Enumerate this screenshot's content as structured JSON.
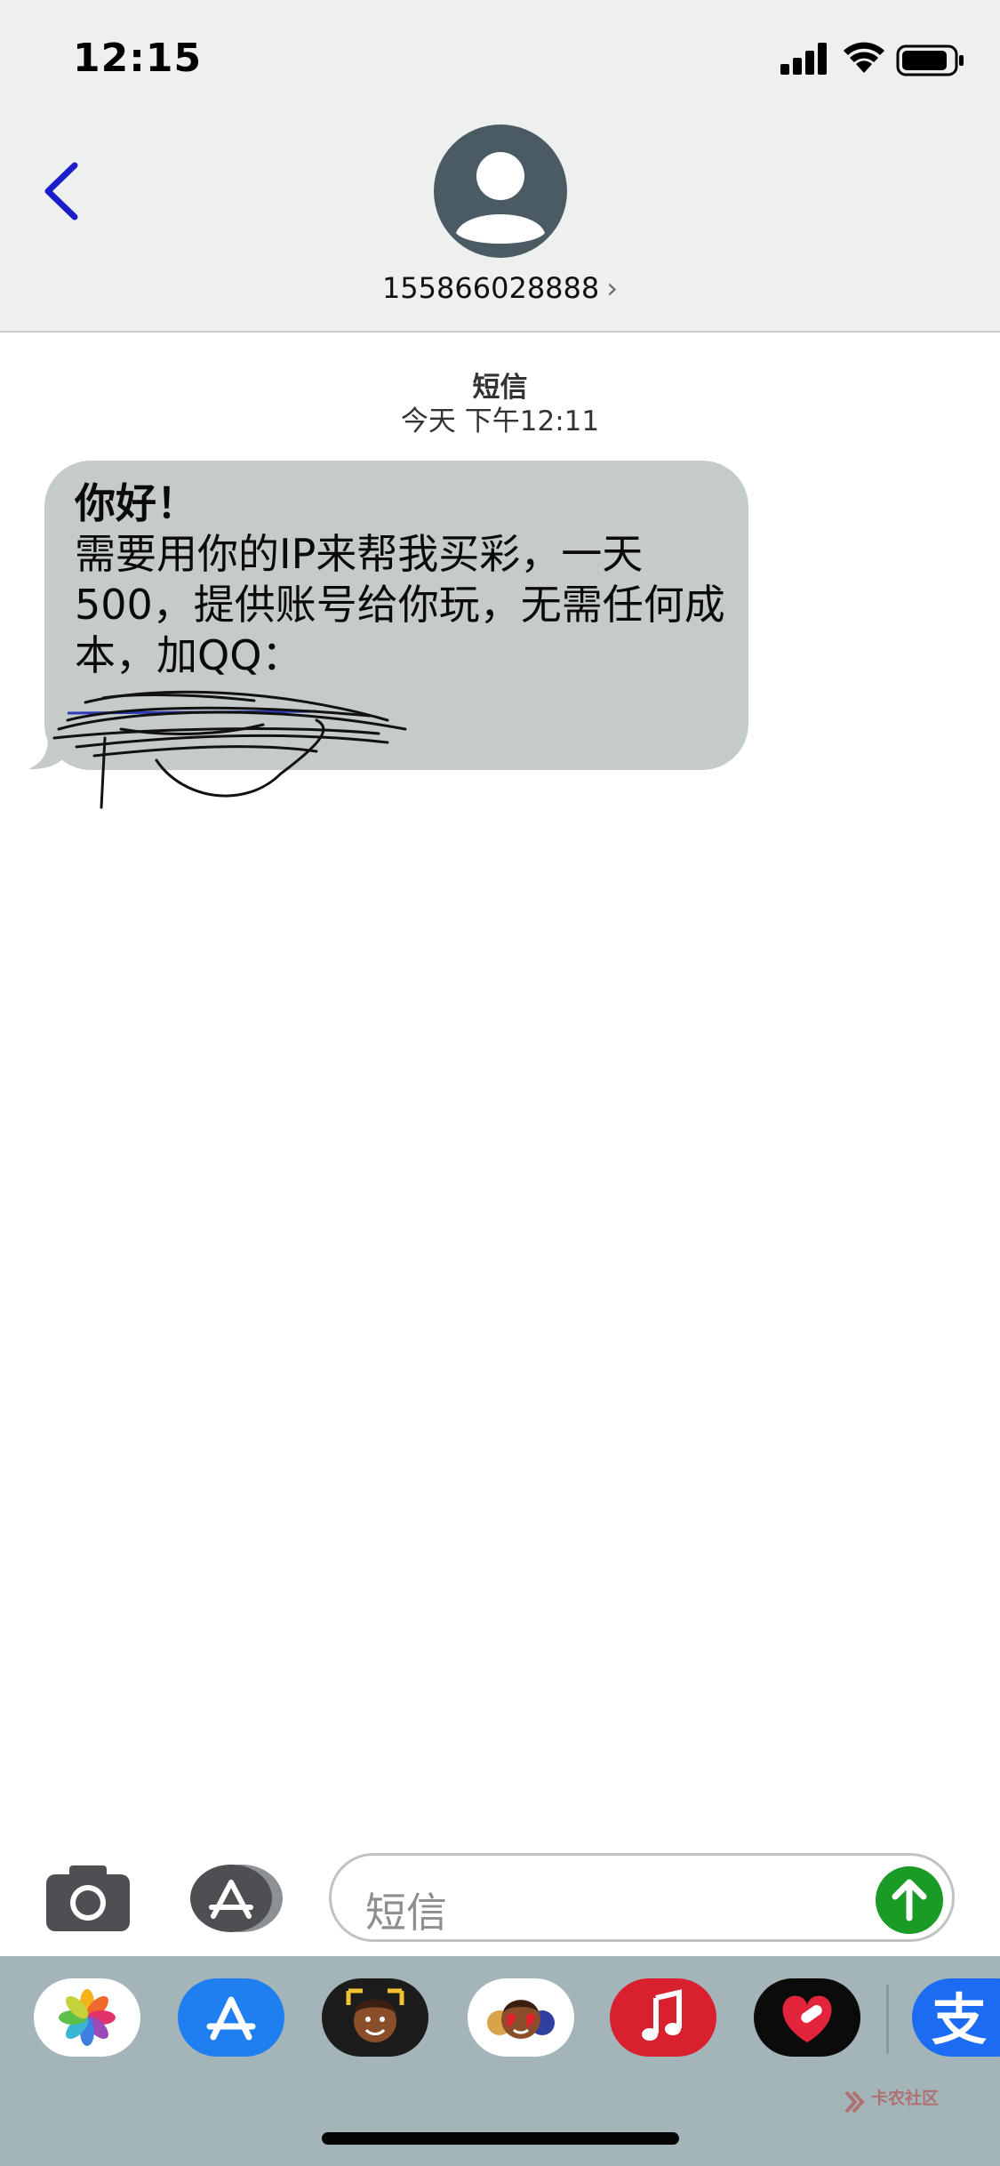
{
  "status_bar": {
    "time": "12:15"
  },
  "header": {
    "contact_number": "155866028888",
    "avatar_icon": "person-icon",
    "back_icon": "chevron-left-icon",
    "accent": "#1c1ec8"
  },
  "thread": {
    "service_label": "短信",
    "timestamp": "今天 下午12:11",
    "messages": [
      {
        "sender": "incoming",
        "greeting": "你好！",
        "body": "需要用你的IP来帮我买彩，一天500，提供账号给你玩，无需任何成本，加QQ：",
        "redacted_text": "<redacted: scribbled-over QQ number>"
      }
    ]
  },
  "compose": {
    "placeholder": "短信",
    "camera_icon": "camera-icon",
    "apps_icon": "app-store-icon",
    "send_icon": "send-arrow-icon",
    "send_color": "#1a9b26"
  },
  "dock": {
    "apps": [
      "photos-icon",
      "app-store-icon",
      "memoji-icon",
      "memoji-stickers-icon",
      "music-icon",
      "fitness-icon",
      "alipay-icon"
    ]
  },
  "watermark": {
    "text": "卡农社区"
  }
}
